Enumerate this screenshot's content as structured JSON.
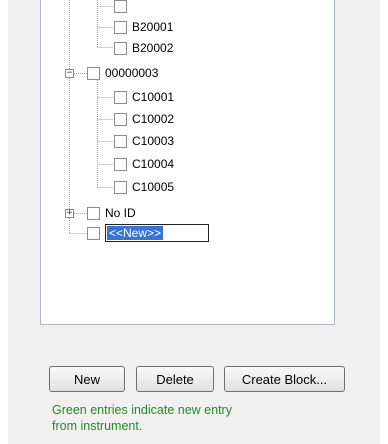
{
  "tree": {
    "nodes": [
      {
        "label": "",
        "depth": 2
      },
      {
        "label": "B20001",
        "depth": 2
      },
      {
        "label": "B20002",
        "depth": 2
      },
      {
        "label": "00000003",
        "depth": 1,
        "expander": "minus"
      },
      {
        "label": "C10001",
        "depth": 2
      },
      {
        "label": "C10002",
        "depth": 2
      },
      {
        "label": "C10003",
        "depth": 2
      },
      {
        "label": "C10004",
        "depth": 2
      },
      {
        "label": "C10005",
        "depth": 2
      },
      {
        "label": "No ID",
        "depth": 1,
        "expander": "plus"
      },
      {
        "label": "<<New>>",
        "depth": 1,
        "editing": true
      }
    ]
  },
  "buttons": {
    "new_label": "New",
    "delete_label": "Delete",
    "create_block_label": "Create Block..."
  },
  "hint": {
    "line1": "Green entries indicate new entry",
    "line2": "from instrument."
  },
  "colors": {
    "hint_text": "#238b23",
    "selection": "#3874d8",
    "panel_bg": "#f0f0f0"
  }
}
